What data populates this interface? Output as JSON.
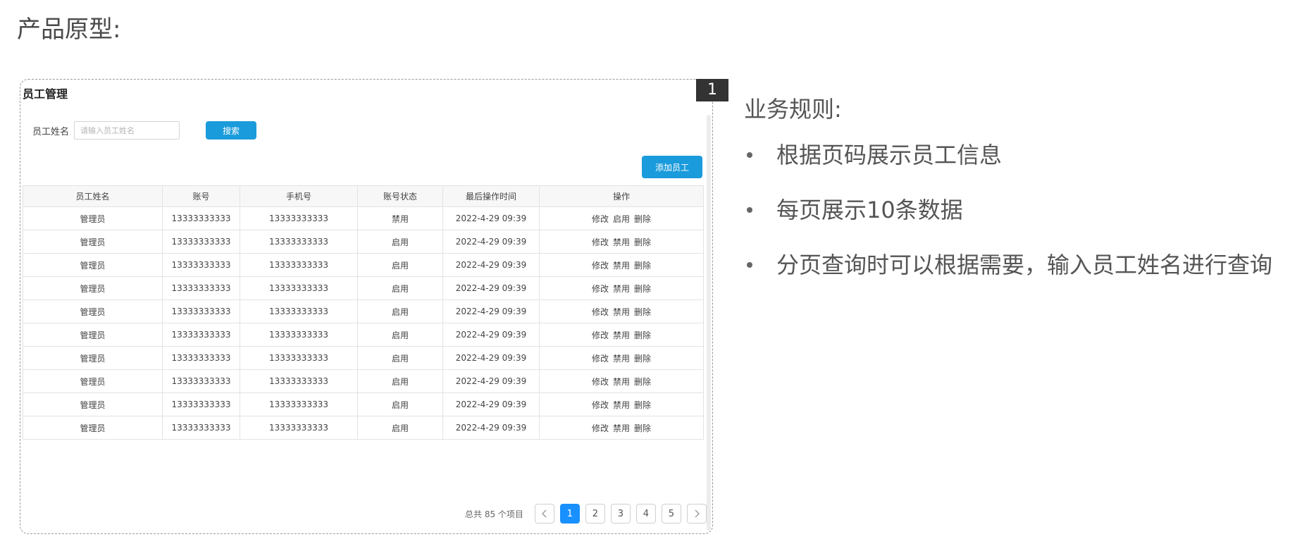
{
  "page": {
    "title": "产品原型:"
  },
  "frame": {
    "badge": "1"
  },
  "panel": {
    "title": "员工管理",
    "search": {
      "label": "员工姓名",
      "placeholder": "请输入员工姓名",
      "value": "",
      "button": "搜索"
    },
    "add_button": "添加员工"
  },
  "table": {
    "columns": [
      "员工姓名",
      "账号",
      "手机号",
      "账号状态",
      "最后操作时间",
      "操作"
    ],
    "rows": [
      {
        "name": "管理员",
        "account": "13333333333",
        "phone": "13333333333",
        "status": "禁用",
        "time": "2022-4-29 09:39",
        "ops": [
          "修改",
          "启用",
          "删除"
        ]
      },
      {
        "name": "管理员",
        "account": "13333333333",
        "phone": "13333333333",
        "status": "启用",
        "time": "2022-4-29 09:39",
        "ops": [
          "修改",
          "禁用",
          "删除"
        ]
      },
      {
        "name": "管理员",
        "account": "13333333333",
        "phone": "13333333333",
        "status": "启用",
        "time": "2022-4-29 09:39",
        "ops": [
          "修改",
          "禁用",
          "删除"
        ]
      },
      {
        "name": "管理员",
        "account": "13333333333",
        "phone": "13333333333",
        "status": "启用",
        "time": "2022-4-29 09:39",
        "ops": [
          "修改",
          "禁用",
          "删除"
        ]
      },
      {
        "name": "管理员",
        "account": "13333333333",
        "phone": "13333333333",
        "status": "启用",
        "time": "2022-4-29 09:39",
        "ops": [
          "修改",
          "禁用",
          "删除"
        ]
      },
      {
        "name": "管理员",
        "account": "13333333333",
        "phone": "13333333333",
        "status": "启用",
        "time": "2022-4-29 09:39",
        "ops": [
          "修改",
          "禁用",
          "删除"
        ]
      },
      {
        "name": "管理员",
        "account": "13333333333",
        "phone": "13333333333",
        "status": "启用",
        "time": "2022-4-29 09:39",
        "ops": [
          "修改",
          "禁用",
          "删除"
        ]
      },
      {
        "name": "管理员",
        "account": "13333333333",
        "phone": "13333333333",
        "status": "启用",
        "time": "2022-4-29 09:39",
        "ops": [
          "修改",
          "禁用",
          "删除"
        ]
      },
      {
        "name": "管理员",
        "account": "13333333333",
        "phone": "13333333333",
        "status": "启用",
        "time": "2022-4-29 09:39",
        "ops": [
          "修改",
          "禁用",
          "删除"
        ]
      },
      {
        "name": "管理员",
        "account": "13333333333",
        "phone": "13333333333",
        "status": "启用",
        "time": "2022-4-29 09:39",
        "ops": [
          "修改",
          "禁用",
          "删除"
        ]
      }
    ]
  },
  "pagination": {
    "total_text": "总共 85 个项目",
    "pages": [
      "1",
      "2",
      "3",
      "4",
      "5"
    ],
    "current": "1",
    "prev_icon": "chevron-left-icon",
    "next_icon": "chevron-right-icon"
  },
  "rules": {
    "title": "业务规则:",
    "items": [
      "根据页码展示员工信息",
      "每页展示10条数据",
      "分页查询时可以根据需要，输入员工姓名进行查询"
    ]
  },
  "colors": {
    "primary": "#1a9bdb",
    "page_active": "#1890ff",
    "badge_bg": "#333333"
  }
}
